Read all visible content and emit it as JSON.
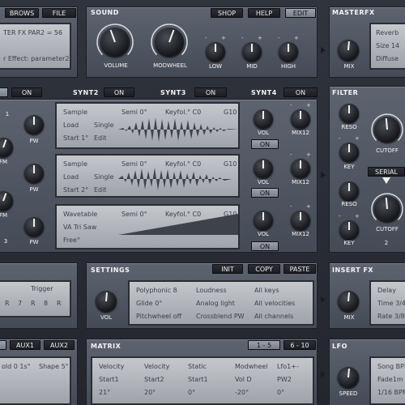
{
  "top": {
    "brows": "BROWS",
    "file": "FILE",
    "lcd_line1": "TER FX PAR2 = 56",
    "lcd_line2": "r Effect: parameter2."
  },
  "sound": {
    "title": "SOUND",
    "shop": "SHOP",
    "help": "HELP",
    "edit": "EDIT",
    "volume": "VOLUME",
    "modwheel": "MODWHEEL",
    "low": "LOW",
    "mid": "MID",
    "high": "HIGH"
  },
  "masterfx": {
    "title": "MASTERFX",
    "l1": "Reverb",
    "l2": "Size 14",
    "l3": "Diffuse",
    "mix": "MIX"
  },
  "synth": {
    "on": "ON",
    "synt2": "SYNT2",
    "synt3": "SYNT3",
    "synt4": "SYNT4",
    "rows": [
      {
        "a": "Sample",
        "b": "Semi 0°",
        "c": "Keyfol.° C0",
        "d": "G10",
        "e": "Load",
        "f": "Single",
        "g": "Start 1°",
        "h": "Edit"
      },
      {
        "a": "Sample",
        "b": "Semi 0°",
        "c": "Keyfol.° C0",
        "d": "G10",
        "e": "Load",
        "f": "Single",
        "g": "Start 2°",
        "h": "Edit"
      },
      {
        "a": "Wavetable",
        "b": "Semi 0°",
        "c": "Keyfol.° C0",
        "d": "G10",
        "e": "VA Tri Saw",
        "f": "",
        "g": "Free°",
        "h": ""
      }
    ],
    "pw": "PW",
    "fm": "FM",
    "n1": "1",
    "n3": "3",
    "vol": "VOL",
    "mix12": "MIX12"
  },
  "filter": {
    "title": "FILTER",
    "reso": "RESO",
    "key": "KEY",
    "cutoff": "CUTOFF",
    "serial": "SERIAL",
    "n2": "2"
  },
  "settings": {
    "title": "SETTINGS",
    "init": "INIT",
    "copy": "COPY",
    "paste": "PASTE",
    "vol": "VOL",
    "c1": [
      "Polyphonic 8",
      "Glide 0°",
      "Pitchwheel off"
    ],
    "c2": [
      "Loudness",
      "Analog light",
      "Crossblend PW"
    ],
    "c3": [
      "All keys",
      "All velocities",
      "All channels"
    ]
  },
  "trigger": {
    "label": "Trigger",
    "letters": [
      "R",
      "7",
      "R",
      "8",
      "R"
    ]
  },
  "insertfx": {
    "title": "INSERT FX",
    "l1": "Delay",
    "l2": "Time 3/4",
    "l3": "Rate 3/8",
    "mix": "MIX"
  },
  "aux": {
    "aux1": "AUX1",
    "aux2": "AUX2",
    "hold": "old 0 1s°",
    "shape": "Shape 5°"
  },
  "matrix": {
    "title": "MATRIX",
    "p1": "1 - 5",
    "p2": "6 - 10",
    "cols": [
      [
        "Velocity",
        "Start1",
        "21°"
      ],
      [
        "Velocity",
        "Start2",
        "20°"
      ],
      [
        "Static",
        "Start1",
        "0°"
      ],
      [
        "Modwheel",
        "Vol D",
        "-20°"
      ],
      [
        "Lfo1+-",
        "PW2",
        "0°"
      ]
    ]
  },
  "lfo": {
    "title": "LFO",
    "l1": "Song BPM",
    "l2": "Fade1m",
    "l3": "1/16 BPM",
    "speed": "SPEED"
  },
  "pm": {
    "minus": "-",
    "plus": "+"
  }
}
